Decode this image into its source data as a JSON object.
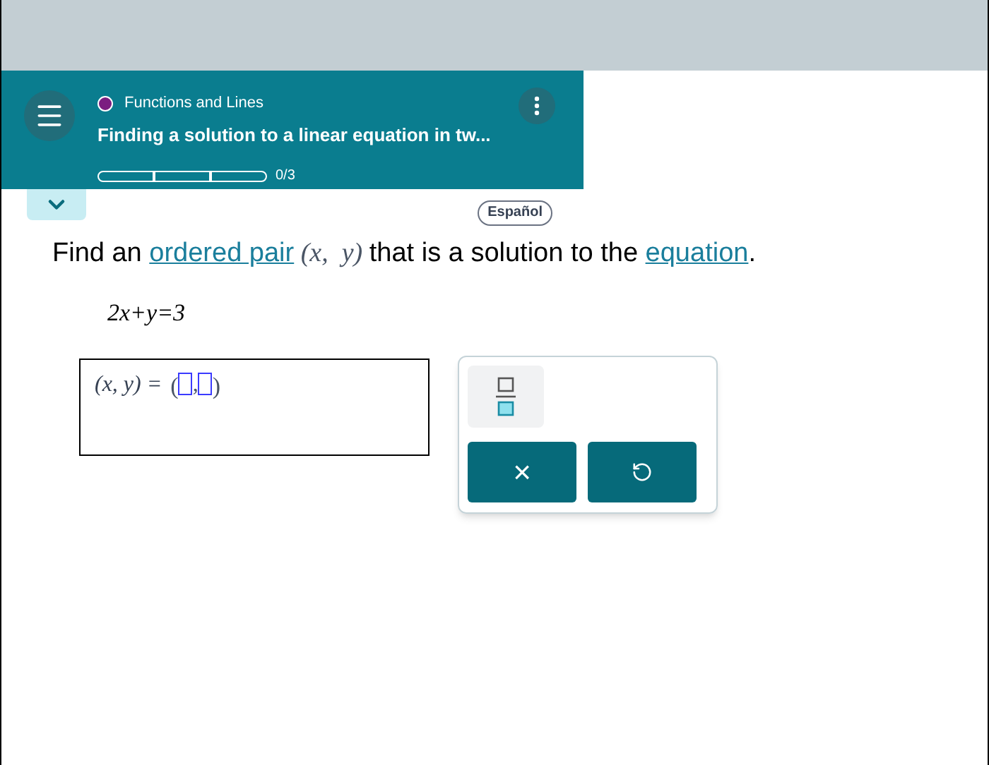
{
  "header": {
    "topic": "Functions and Lines",
    "title": "Finding a solution to a linear equation in tw...",
    "progress": {
      "segments": [
        {
          "filled": false
        },
        {
          "filled": false
        },
        {
          "filled": false
        }
      ],
      "label": "0/3"
    }
  },
  "language_button": "Español",
  "prompt": [
    {
      "kind": "text",
      "text": "Find an "
    },
    {
      "kind": "link",
      "text": "ordered pair"
    },
    {
      "kind": "math",
      "text": " (x,  y) "
    },
    {
      "kind": "text",
      "text": "that is a solution to the "
    },
    {
      "kind": "link",
      "text": "equation"
    },
    {
      "kind": "text",
      "text": "."
    }
  ],
  "equation": "2x+y=3",
  "answer": {
    "label": "(x, y) =",
    "open": "(",
    "separator": ",",
    "close": ")"
  },
  "keypad": {
    "clear_key": "×"
  }
}
